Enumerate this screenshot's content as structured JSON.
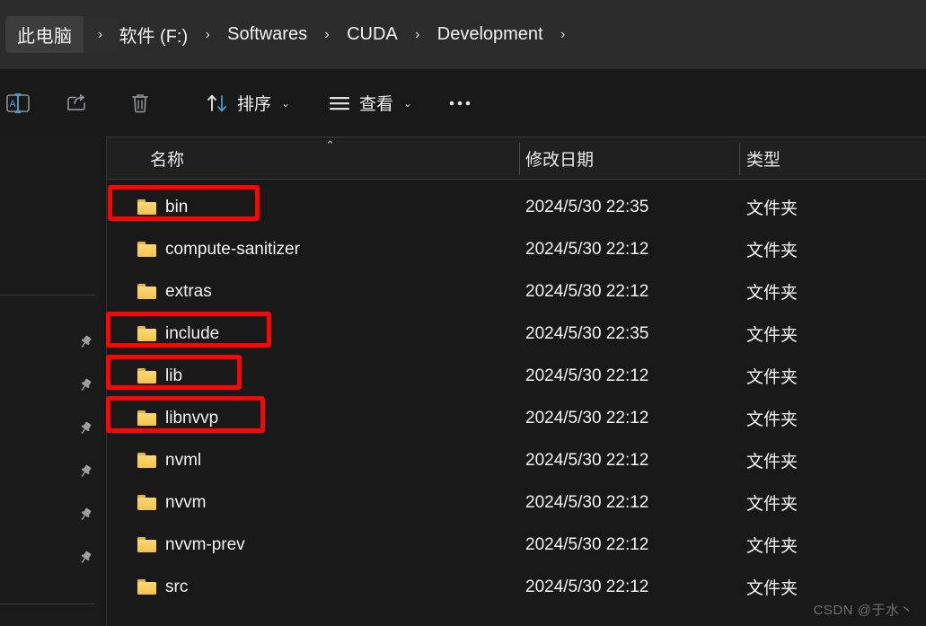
{
  "window": {
    "background": "#191919",
    "accent_red": "#fb0505",
    "folder_yellow": "#f4c24a"
  },
  "addressbar": {
    "root": {
      "label": "此电脑",
      "chevron": "›"
    },
    "crumbs": [
      {
        "label": "软件 (F:)",
        "sep": "›"
      },
      {
        "label": "Softwares",
        "sep": "›"
      },
      {
        "label": "CUDA",
        "sep": "›"
      },
      {
        "label": "Development",
        "sep": "›"
      }
    ]
  },
  "toolbar": {
    "items": [
      {
        "icon": "rename-icon",
        "label": "",
        "caret": ""
      },
      {
        "icon": "share-icon",
        "label": "",
        "caret": ""
      },
      {
        "icon": "delete-icon",
        "label": "",
        "caret": ""
      },
      {
        "icon": "sort-icon",
        "label": "排序",
        "caret": "⌄"
      },
      {
        "icon": "view-icon",
        "label": "查看",
        "caret": "⌄"
      },
      {
        "icon": "more-icon",
        "label": "",
        "caret": ""
      }
    ]
  },
  "sidebar": {
    "pins": [
      {
        "icon": "pin-icon"
      },
      {
        "icon": "pin-icon"
      },
      {
        "icon": "pin-icon"
      },
      {
        "icon": "pin-icon"
      },
      {
        "icon": "pin-icon"
      },
      {
        "icon": "pin-icon"
      }
    ]
  },
  "filelist": {
    "columns": [
      {
        "key": "name",
        "label": "名称",
        "sorted": "asc",
        "sort_glyph": "⌃"
      },
      {
        "key": "date",
        "label": "修改日期"
      },
      {
        "key": "type",
        "label": "类型"
      }
    ],
    "rows": [
      {
        "icon": "folder-icon",
        "name": "bin",
        "date": "2024/5/30 22:35",
        "type": "文件夹",
        "highlighted": true
      },
      {
        "icon": "folder-icon",
        "name": "compute-sanitizer",
        "date": "2024/5/30 22:12",
        "type": "文件夹",
        "highlighted": false
      },
      {
        "icon": "folder-icon",
        "name": "extras",
        "date": "2024/5/30 22:12",
        "type": "文件夹",
        "highlighted": false
      },
      {
        "icon": "folder-icon",
        "name": "include",
        "date": "2024/5/30 22:35",
        "type": "文件夹",
        "highlighted": true
      },
      {
        "icon": "folder-icon",
        "name": "lib",
        "date": "2024/5/30 22:12",
        "type": "文件夹",
        "highlighted": true
      },
      {
        "icon": "folder-icon",
        "name": "libnvvp",
        "date": "2024/5/30 22:12",
        "type": "文件夹",
        "highlighted": true
      },
      {
        "icon": "folder-icon",
        "name": "nvml",
        "date": "2024/5/30 22:12",
        "type": "文件夹",
        "highlighted": false
      },
      {
        "icon": "folder-icon",
        "name": "nvvm",
        "date": "2024/5/30 22:12",
        "type": "文件夹",
        "highlighted": false
      },
      {
        "icon": "folder-icon",
        "name": "nvvm-prev",
        "date": "2024/5/30 22:12",
        "type": "文件夹",
        "highlighted": false
      },
      {
        "icon": "folder-icon",
        "name": "src",
        "date": "2024/5/30 22:12",
        "type": "文件夹",
        "highlighted": false
      }
    ]
  },
  "watermark": {
    "text": "CSDN @于水丶"
  }
}
